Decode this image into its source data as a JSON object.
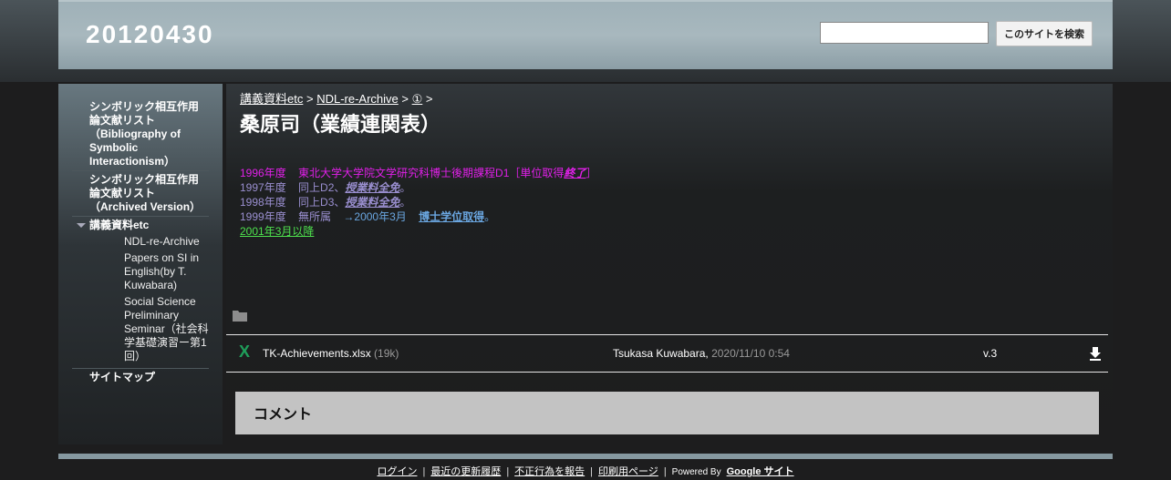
{
  "site": {
    "title": "20120430"
  },
  "search": {
    "placeholder": "",
    "button_label": "このサイトを検索"
  },
  "sidebar": {
    "items": [
      {
        "label": "シンボリック相互作用論文献リスト（Bibliography of Symbolic Interactionism）"
      },
      {
        "label": "シンボリック相互作用論文献リスト（Archived Version）"
      },
      {
        "label": "講義資料etc",
        "children": [
          {
            "label": "NDL-re-Archive"
          },
          {
            "label": "Papers on SI in English(by T. Kuwabara)"
          },
          {
            "label": "Social Science Preliminary Seminar（社会科学基礎演習ー第1回）"
          }
        ]
      },
      {
        "label": "サイトマップ"
      }
    ]
  },
  "breadcrumb": {
    "item1": "講義資料etc",
    "item2": "NDL-re-Archive",
    "item3": "①",
    "sep": ">"
  },
  "page": {
    "title": "桑原司（業績連関表）"
  },
  "content": {
    "l1": {
      "year": "1996年度",
      "text": "東北大学大学院文学研究科博士後期課程D1［単位取得",
      "link": "終了",
      "tail": "］"
    },
    "l2": {
      "year": "1997年度",
      "text": "同上D2、",
      "link": "授業料全免",
      "tail": "。"
    },
    "l3": {
      "year": "1998年度",
      "text": "同上D3、",
      "link": "授業料全免",
      "tail": "。"
    },
    "l4": {
      "year": "1999年度",
      "text": "無所属",
      "arrow": "→2000年3月",
      "link": "博士学位取得",
      "tail": "。"
    },
    "l5": {
      "link": "2001年3月以降"
    }
  },
  "attachment": {
    "filename": "TK-Achievements.xlsx",
    "size": "(19k)",
    "author": "Tsukasa Kuwabara,",
    "date": "2020/11/10 0:54",
    "version": "v.3"
  },
  "comments": {
    "title": "コメント"
  },
  "footer": {
    "login": "ログイン",
    "recent": "最近の更新履歴",
    "abuse": "不正行為を報告",
    "print": "印刷用ページ",
    "powered": "Powered By",
    "google": "Google サイト",
    "sep": "|"
  },
  "colors": {
    "magenta": "#e020e8",
    "lavender": "#9a8fd0",
    "blue": "#6aa6e0",
    "green": "#4ee24e",
    "excel": "#1f9e5a"
  }
}
